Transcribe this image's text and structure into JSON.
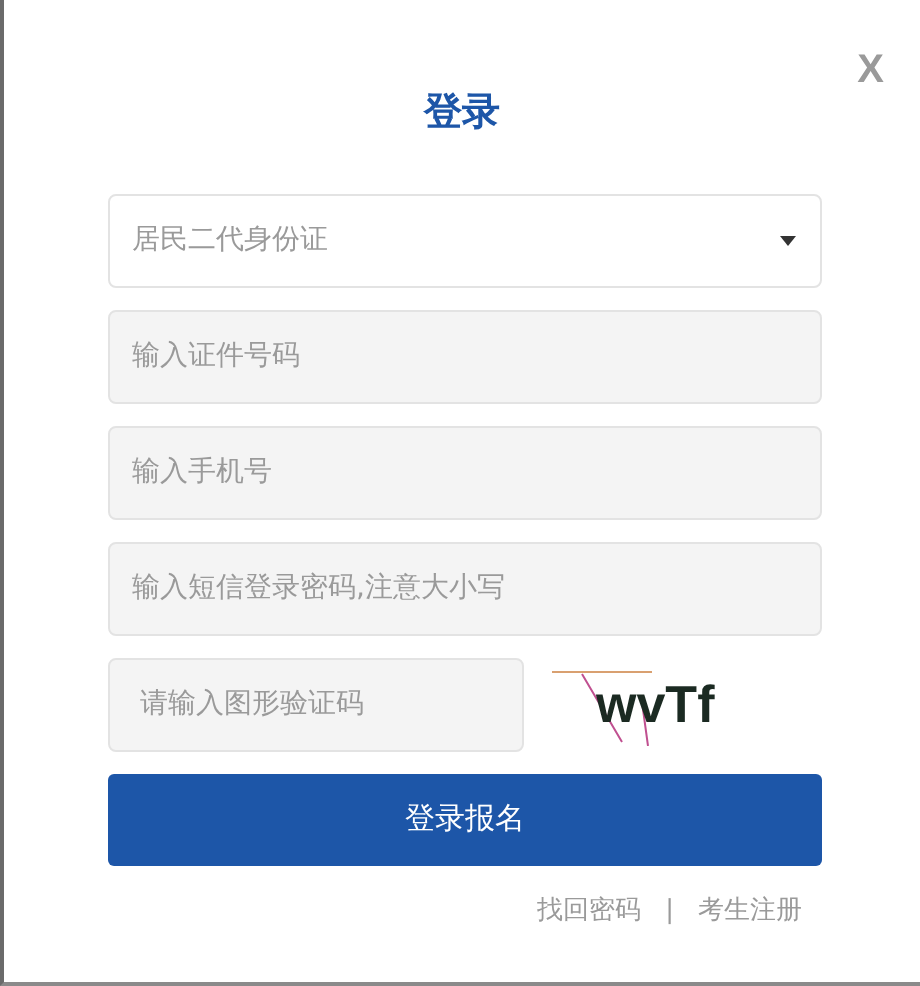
{
  "close": "X",
  "title": "登录",
  "id_type": {
    "value": "居民二代身份证"
  },
  "fields": [
    {
      "placeholder": "输入证件号码"
    },
    {
      "placeholder": "输入手机号"
    },
    {
      "placeholder": "输入短信登录密码,注意大小写"
    }
  ],
  "captcha": {
    "placeholder": "请输入图形验证码",
    "code": "wvTf"
  },
  "submit": "登录报名",
  "links": [
    "找回密码",
    "考生注册"
  ],
  "separator": "|"
}
